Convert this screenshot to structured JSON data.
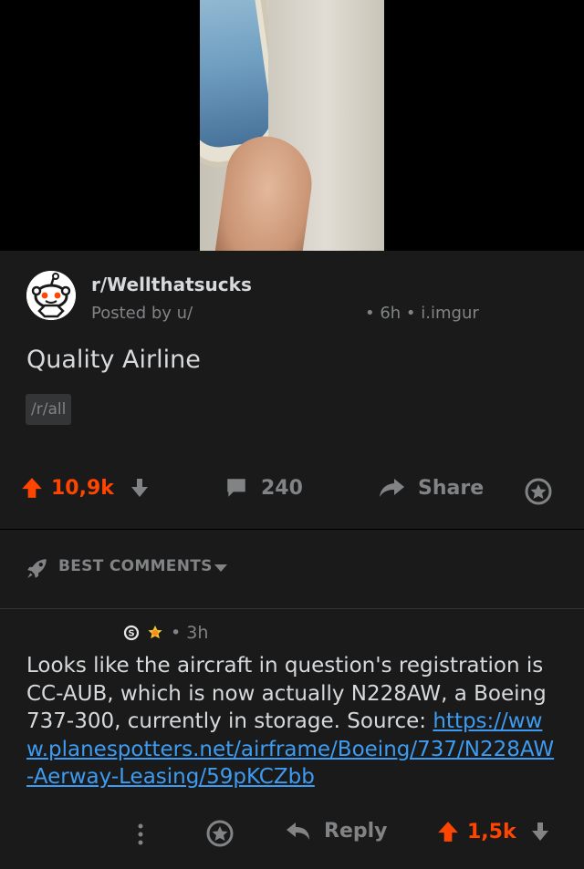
{
  "post": {
    "subreddit": "r/Wellthatsucks",
    "posted_by": "Posted by u/",
    "meta": "• 6h • i.imgur",
    "title": "Quality Airline",
    "flair": "/r/all",
    "score": "10,9k",
    "comments": "240",
    "share_label": "Share"
  },
  "sort": {
    "label": "BEST COMMENTS"
  },
  "comment": {
    "age": "• 3h",
    "text": "Looks like the aircraft in question's registration is CC-AUB, which is now actually N228AW, a Boeing 737-300, currently in storage. Source:",
    "link": "https://www.planespotters.net/airframe/Boeing/737/N228AW-Aerway-Leasing/59pKCZbb",
    "reply_label": "Reply",
    "score": "1,5k"
  },
  "colors": {
    "upvote": "#ff4500",
    "muted": "#818384",
    "link": "#3d9cf1",
    "background": "#1a1a1b"
  }
}
